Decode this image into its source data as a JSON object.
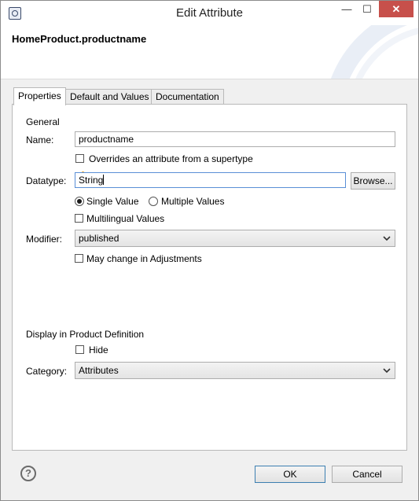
{
  "window": {
    "title": "Edit Attribute",
    "minimize_glyph": "—",
    "maximize_glyph": "☐",
    "close_glyph": "✕"
  },
  "banner": {
    "title": "HomeProduct.productname"
  },
  "tabs": [
    {
      "label": "Properties",
      "active": true
    },
    {
      "label": "Default and Values",
      "active": false
    },
    {
      "label": "Documentation",
      "active": false
    }
  ],
  "general": {
    "section_label": "General",
    "name_label": "Name:",
    "name_value": "productname",
    "overrides_label": "Overrides an attribute from a supertype",
    "overrides_checked": false,
    "datatype_label": "Datatype:",
    "datatype_value": "String",
    "browse_label": "Browse...",
    "single_value_label": "Single Value",
    "single_value_selected": true,
    "multiple_values_label": "Multiple Values",
    "multiple_values_selected": false,
    "multilingual_label": "Multilingual Values",
    "multilingual_checked": false,
    "modifier_label": "Modifier:",
    "modifier_value": "published",
    "may_change_label": "May change in Adjustments",
    "may_change_checked": false
  },
  "display": {
    "section_label": "Display in Product Definition",
    "hide_label": "Hide",
    "hide_checked": false,
    "category_label": "Category:",
    "category_value": "Attributes"
  },
  "footer": {
    "help_glyph": "?",
    "ok_label": "OK",
    "cancel_label": "Cancel"
  },
  "colors": {
    "close_button": "#c7504b",
    "focus_border": "#5a8fd6",
    "default_button_border": "#3c7fb1"
  }
}
